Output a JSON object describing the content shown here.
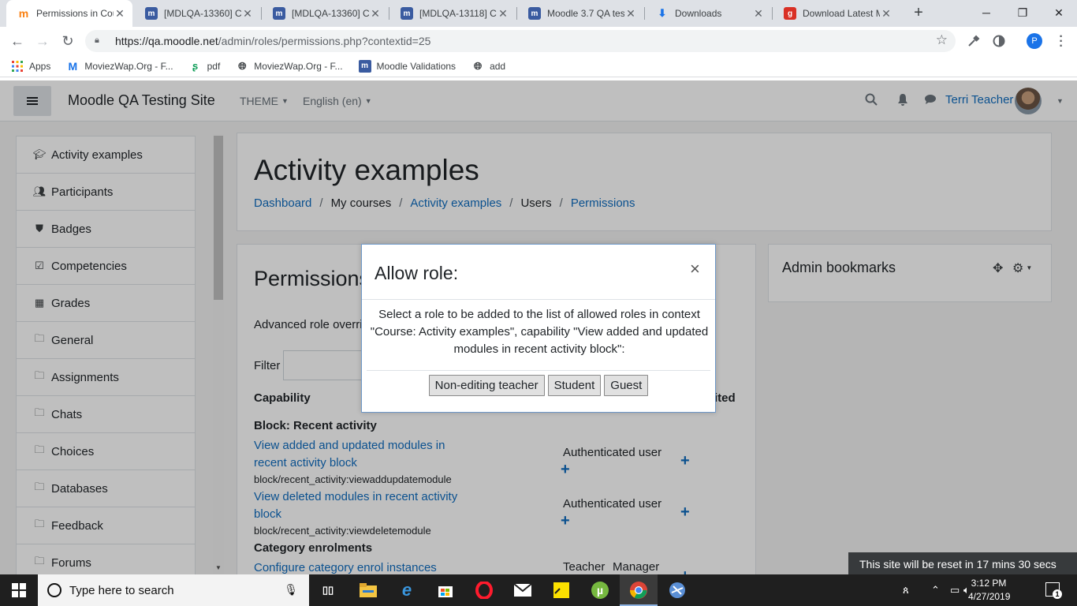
{
  "browser": {
    "tabs": [
      {
        "title": "Permissions in Cou",
        "favicon": "moodle-orange-icon",
        "active": true
      },
      {
        "title": "[MDLQA-13360] C",
        "favicon": "moodle-tracker-icon"
      },
      {
        "title": "[MDLQA-13360] C",
        "favicon": "moodle-tracker-icon"
      },
      {
        "title": "[MDLQA-13118] C",
        "favicon": "moodle-tracker-icon"
      },
      {
        "title": "Moodle 3.7 QA tes",
        "favicon": "moodle-tracker-icon"
      },
      {
        "title": "Downloads",
        "favicon": "download-icon"
      },
      {
        "title": "Download Latest M",
        "favicon": "g-icon"
      }
    ],
    "url_host": "https://qa.moodle.net",
    "url_path": "/admin/roles/permissions.php?contextid=25",
    "profile_initial": "P",
    "bookmarks": [
      {
        "label": "Apps",
        "icon": "apps-grid-icon"
      },
      {
        "label": "MoviezWap.Org - F...",
        "icon": "moviezwap-icon"
      },
      {
        "label": "pdf",
        "icon": "pdf-icon"
      },
      {
        "label": "MoviezWap.Org - F...",
        "icon": "globe-icon"
      },
      {
        "label": "Moodle Validations",
        "icon": "moodle-tracker-icon"
      },
      {
        "label": "add",
        "icon": "globe-icon"
      }
    ]
  },
  "navbar": {
    "site_name": "Moodle QA Testing Site",
    "theme_label": "THEME",
    "language_label": "English (en)",
    "user_name": "Terri Teacher"
  },
  "drawer": {
    "items": [
      {
        "label": "Activity examples",
        "icon": "graduation-cap-icon"
      },
      {
        "label": "Participants",
        "icon": "users-icon"
      },
      {
        "label": "Badges",
        "icon": "shield-icon"
      },
      {
        "label": "Competencies",
        "icon": "checkbox-icon"
      },
      {
        "label": "Grades",
        "icon": "table-icon"
      },
      {
        "label": "General",
        "icon": "folder-icon"
      },
      {
        "label": "Assignments",
        "icon": "folder-icon"
      },
      {
        "label": "Chats",
        "icon": "folder-icon"
      },
      {
        "label": "Choices",
        "icon": "folder-icon"
      },
      {
        "label": "Databases",
        "icon": "folder-icon"
      },
      {
        "label": "Feedback",
        "icon": "folder-icon"
      },
      {
        "label": "Forums",
        "icon": "folder-icon"
      }
    ]
  },
  "header": {
    "title": "Activity examples",
    "breadcrumb": [
      {
        "label": "Dashboard",
        "link": true
      },
      {
        "label": "My courses",
        "link": false
      },
      {
        "label": "Activity examples",
        "link": true
      },
      {
        "label": "Users",
        "link": false
      },
      {
        "label": "Permissions",
        "link": true
      }
    ]
  },
  "main": {
    "title": "Permissions",
    "advanced_text": "Advanced role overri",
    "filter_label": "Filter",
    "col_capability": "Capability",
    "col_prohibited": "ited",
    "sections": [
      {
        "heading": "Block: Recent activity"
      },
      {
        "heading": "Category enrolments"
      }
    ],
    "capabilities": [
      {
        "name": "View added and updated modules in recent activity block",
        "code": "block/recent_activity:viewaddupdatemodule",
        "roles": "Authenticated user"
      },
      {
        "name": "View deleted modules in recent activity block",
        "code": "block/recent_activity:viewdeletemodule",
        "roles": "Authenticated user"
      },
      {
        "name": "Configure category enrol instances",
        "roles_a": "Teacher",
        "roles_b": "Manager"
      }
    ]
  },
  "admin_bookmarks": {
    "title": "Admin bookmarks"
  },
  "modal": {
    "title": "Allow role:",
    "body": "Select a role to be added to the list of allowed roles in context \"Course: Activity examples\", capability \"View added and updated modules in recent activity block\":",
    "buttons": [
      "Non-editing teacher",
      "Student",
      "Guest"
    ]
  },
  "reset_banner": "This site will be reset in 17 mins 30 secs",
  "taskbar": {
    "search_placeholder": "Type here to search",
    "time": "3:12 PM",
    "date": "4/27/2019",
    "notification_count": "1"
  }
}
